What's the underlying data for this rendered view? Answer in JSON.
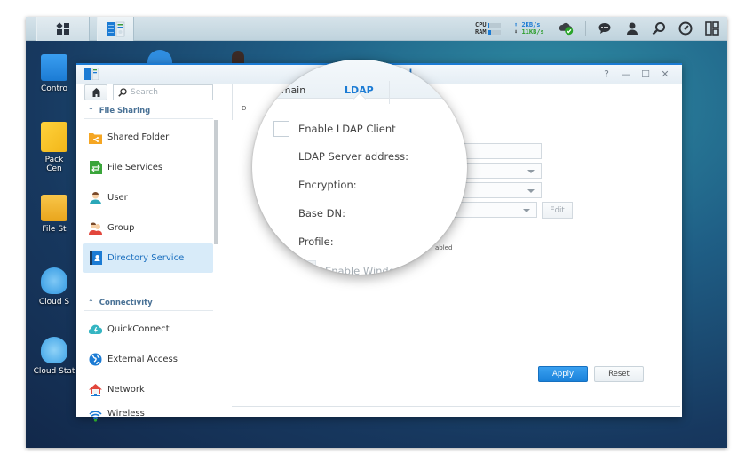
{
  "taskbar": {
    "main_menu_icon": "main-menu-icon",
    "open_app_icon": "control-panel-icon",
    "resource_monitor": {
      "cpu_label": "CPU",
      "ram_label": "RAM",
      "cpu_usage": 0.05,
      "ram_usage": 0.25
    },
    "network": {
      "upload": "2KB/s",
      "download": "11KB/s"
    },
    "tray_icons": [
      "cloud-sync-status-icon",
      "chat-icon",
      "user-icon",
      "search-icon",
      "widgets-icon",
      "window-layout-icon"
    ]
  },
  "desktop": {
    "icons": [
      {
        "label": "Contro",
        "icon": "control-panel-icon"
      },
      {
        "label": "Pack",
        "label2": "Cen",
        "icon": "package-center-icon"
      },
      {
        "label": "File St",
        "icon": "file-station-icon"
      },
      {
        "label": "Cloud S",
        "icon": "cloud-sync-icon"
      },
      {
        "label": "Cloud Stat",
        "icon": "cloud-station-icon"
      }
    ]
  },
  "window": {
    "title_partial": "el",
    "controls": {
      "help": "?",
      "minimize": "—",
      "maximize": "☐",
      "close": "✕"
    },
    "search_placeholder": "Search",
    "sidebar": {
      "sections": [
        {
          "label": "File Sharing",
          "items": [
            {
              "label": "Shared Folder",
              "icon": "shared-folder-icon"
            },
            {
              "label": "File Services",
              "icon": "file-services-icon"
            },
            {
              "label": "User",
              "icon": "user-icon"
            },
            {
              "label": "Group",
              "icon": "group-icon"
            },
            {
              "label": "Directory Service",
              "icon": "directory-service-icon",
              "active": true
            }
          ]
        },
        {
          "label": "Connectivity",
          "items": [
            {
              "label": "QuickConnect",
              "icon": "quickconnect-icon"
            },
            {
              "label": "External Access",
              "icon": "external-access-icon"
            },
            {
              "label": "Network",
              "icon": "network-icon"
            },
            {
              "label": "Wireless",
              "icon": "wireless-icon"
            }
          ]
        }
      ]
    },
    "content": {
      "tabs": [
        {
          "label": "omain"
        },
        {
          "label": "LDAP",
          "active": true
        }
      ],
      "subtab_partial": "D",
      "form": {
        "enable_ldap_label": "Enable LDAP Client",
        "enable_ldap_checked": false,
        "server_address_label": "LDAP Server address:",
        "server_address_value": "",
        "encryption_label": "Encryption:",
        "encryption_value": "",
        "base_dn_label": "Base DN:",
        "base_dn_value": "",
        "profile_label": "Profile:",
        "profile_value": "",
        "edit_label": "Edit",
        "enabled_note_partial": "abled",
        "enable_windows_label": "Enable Window"
      },
      "apply_label": "Apply",
      "reset_label": "Reset"
    }
  }
}
